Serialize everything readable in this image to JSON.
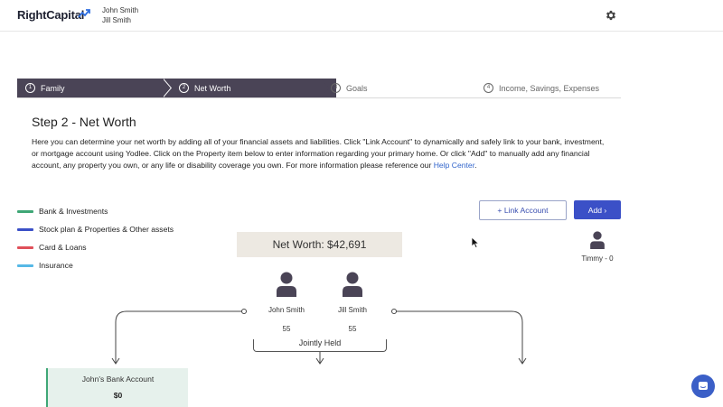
{
  "header": {
    "logo_text": "RightCapital",
    "users": [
      "John Smith",
      "Jill Smith"
    ]
  },
  "steps": [
    {
      "num": "1",
      "label": "Family",
      "state": "done"
    },
    {
      "num": "2",
      "label": "Net Worth",
      "state": "active"
    },
    {
      "num": "3",
      "label": "Goals",
      "state": "upcoming"
    },
    {
      "num": "4",
      "label": "Income, Savings, Expenses",
      "state": "upcoming"
    }
  ],
  "main": {
    "title": "Step 2 - Net Worth",
    "description": "Here you can determine your net worth by adding all of your financial assets and liabilities. Click \"Link Account\" to dynamically and safely link to your bank, investment, or mortgage account using Yodlee. Click on the Property item below to enter information regarding your primary home. Or click \"Add\" to manually add any financial account, any property you own, or any life or disability coverage you own. For more information please reference our ",
    "help_link": "Help Center",
    "help_suffix": "."
  },
  "legend": [
    {
      "label": "Bank & Investments",
      "color": "#3fa776"
    },
    {
      "label": "Stock plan & Properties & Other assets",
      "color": "#3b50c7"
    },
    {
      "label": "Card & Loans",
      "color": "#e0505a"
    },
    {
      "label": "Insurance",
      "color": "#56b8e6"
    }
  ],
  "buttons": {
    "link_account": "+  Link Account",
    "add": "Add  ›"
  },
  "net_worth": "Net Worth: $42,691",
  "people": [
    {
      "name": "John Smith",
      "age": "55"
    },
    {
      "name": "Jill Smith",
      "age": "55"
    },
    {
      "name": "Timmy - 0"
    }
  ],
  "jointly_held": "Jointly Held",
  "account": {
    "name": "John's Bank Account",
    "value": "$0"
  },
  "colors": {
    "accent": "#3b50c7",
    "stepper": "#4a4456",
    "net_worth_bg": "#ede9e2"
  }
}
